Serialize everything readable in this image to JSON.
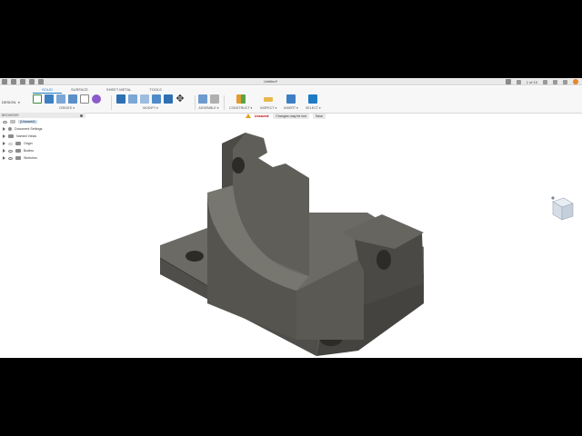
{
  "title_bar": {
    "document_title": "Untitled*",
    "job_status": "1 of 10",
    "icons": [
      "app-menu-icon",
      "file-icon",
      "save-icon",
      "undo-icon",
      "redo-icon",
      "add-tab-icon",
      "extensions-icon",
      "job-status-icon",
      "notifications-icon",
      "help-icon",
      "user-avatar-icon"
    ]
  },
  "toolbar": {
    "workspace": "DESIGN",
    "tabs": [
      {
        "label": "SOLID",
        "active": true
      },
      {
        "label": "SURFACE",
        "active": false
      },
      {
        "label": "SHEET METAL",
        "active": false
      },
      {
        "label": "TOOLS",
        "active": false
      }
    ],
    "groups": {
      "create": "CREATE",
      "modify": "MODIFY",
      "assemble": "ASSEMBLE",
      "construct": "CONSTRUCT",
      "inspect": "INSPECT",
      "insert": "INSERT",
      "select": "SELECT"
    }
  },
  "message_bar": {
    "unsaved": "Unsaved:",
    "changes": "Changes may be lost",
    "save": "Save"
  },
  "browser": {
    "header": "BROWSER",
    "items": [
      {
        "label": "(Unsaved)",
        "icon": "document-icon"
      },
      {
        "label": "Document Settings",
        "icon": "gear-icon"
      },
      {
        "label": "Named Views",
        "icon": "folder-icon"
      },
      {
        "label": "Origin",
        "icon": "folder-icon"
      },
      {
        "label": "Bodies",
        "icon": "folder-icon"
      },
      {
        "label": "Sketches",
        "icon": "folder-icon"
      }
    ]
  },
  "colors": {
    "model_top": "#6b6a65",
    "model_side": "#4a4945",
    "model_dark": "#3a3935",
    "accent": "#1e7cc7"
  }
}
